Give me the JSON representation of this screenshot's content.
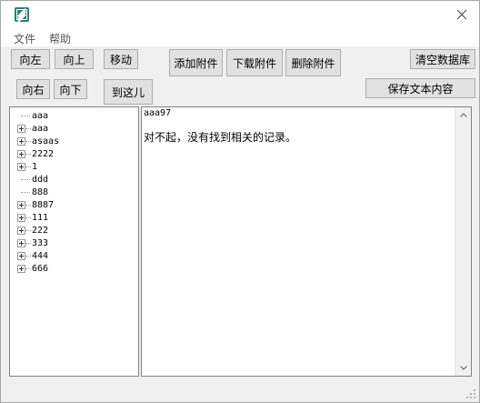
{
  "window": {
    "close_icon": "close-icon",
    "app_icon": "app-icon"
  },
  "menu": {
    "items": [
      "文件",
      "帮助"
    ]
  },
  "toolbar": {
    "left": "向左",
    "up": "向上",
    "move": "移动",
    "right": "向右",
    "down": "向下",
    "goto": "到这儿",
    "add_attachment": "添加附件",
    "download_attachment": "下载附件",
    "delete_attachment": "删除附件",
    "clear_db": "清空数据库",
    "save_text": "保存文本内容"
  },
  "tree": {
    "nodes": [
      {
        "label": "aaa",
        "expandable": false
      },
      {
        "label": "aaa",
        "expandable": true
      },
      {
        "label": "asaas",
        "expandable": true
      },
      {
        "label": "2222",
        "expandable": true
      },
      {
        "label": "1",
        "expandable": true
      },
      {
        "label": "ddd",
        "expandable": false
      },
      {
        "label": "888",
        "expandable": false
      },
      {
        "label": "8887",
        "expandable": true
      },
      {
        "label": "111",
        "expandable": true
      },
      {
        "label": "222",
        "expandable": true
      },
      {
        "label": "333",
        "expandable": true
      },
      {
        "label": "444",
        "expandable": true
      },
      {
        "label": "666",
        "expandable": true
      }
    ]
  },
  "content": {
    "title": "aaa97",
    "message": "对不起，没有找到相关的记录。"
  }
}
